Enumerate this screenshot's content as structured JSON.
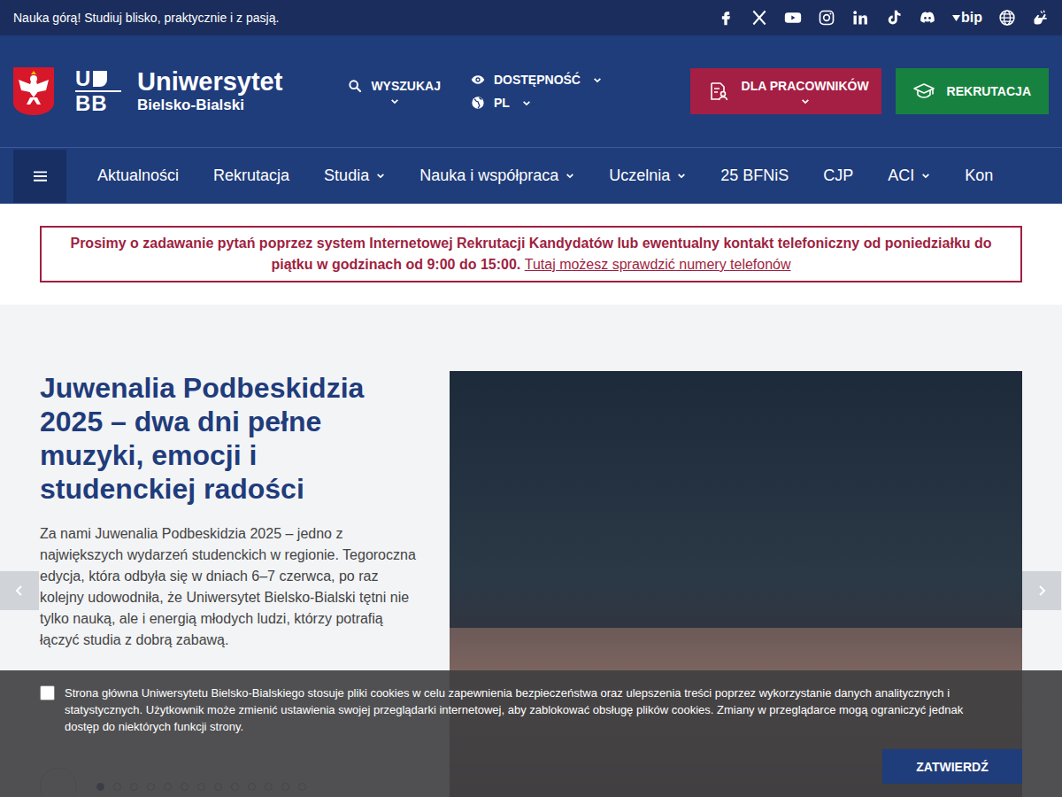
{
  "topbar": {
    "slogan": "Nauka górą! Studiuj blisko, praktycznie i z pasją.",
    "bip_label": "bip"
  },
  "header": {
    "logo_mark_top": "U",
    "logo_mark_bottom": "BB",
    "name": "Uniwersytet",
    "city": "Bielsko-Bialski",
    "search": "WYSZUKAJ",
    "accessibility": "DOSTĘPNOŚĆ",
    "language": "PL",
    "staff_button": "DLA PRACOWNIKÓW",
    "recruitment_button": "REKRUTACJA"
  },
  "nav": {
    "items": [
      {
        "label": "Aktualności",
        "has_dropdown": false
      },
      {
        "label": "Rekrutacja",
        "has_dropdown": false
      },
      {
        "label": "Studia",
        "has_dropdown": true
      },
      {
        "label": "Nauka i współpraca",
        "has_dropdown": true
      },
      {
        "label": "Uczelnia",
        "has_dropdown": true
      },
      {
        "label": "25 BFNiS",
        "has_dropdown": false
      },
      {
        "label": "CJP",
        "has_dropdown": false
      },
      {
        "label": "ACI",
        "has_dropdown": true
      },
      {
        "label": "Kon",
        "has_dropdown": false
      }
    ]
  },
  "notice": {
    "text": "Prosimy o zadawanie pytań poprzez system Internetowej Rekrutacji Kandydatów lub ewentualny kontakt telefoniczny od poniedziałku do piątku w godzinach od 9:00 do 15:00.",
    "link": "Tutaj możesz sprawdzić numery telefonów"
  },
  "slider": {
    "title": "Juwenalia Podbeskidzia 2025 – dwa dni pełne muzyki, emocji i studenckiej radości",
    "text": "Za nami Juwenalia Podbeskidzia 2025 – jedno z największych wydarzeń studenckich w regionie. Tegoroczna edycja, która odbyła się w dniach 6–7 czerwca, po raz kolejny udowodniła, że Uniwersytet Bielsko-Bialski tętni nie tylko nauką, ale i energią młodych ludzi, którzy potrafią łączyć studia z dobrą zabawą.",
    "slides": [
      {
        "selected": true
      },
      {
        "selected": false
      },
      {
        "selected": false
      },
      {
        "selected": false
      },
      {
        "selected": false
      },
      {
        "selected": false
      },
      {
        "selected": false
      },
      {
        "selected": false
      },
      {
        "selected": false
      },
      {
        "selected": false
      },
      {
        "selected": false
      },
      {
        "selected": false
      },
      {
        "selected": false
      }
    ]
  },
  "cookie": {
    "checked": false,
    "text": "Strona główna Uniwersytetu Bielsko-Bialskiego stosuje pliki cookies w celu zapewnienia bezpieczeństwa oraz ulepszenia treści poprzez wykorzystanie danych analitycznych i statystycznych. Użytkownik może zmienić ustawienia swojej przeglądarki internetowej, aby zablokować obsługę plików cookies. Zmiany w przeglądarce mogą ograniczyć jednak dostęp do niektórych funkcji strony.",
    "button": "ZATWIERDŹ"
  }
}
